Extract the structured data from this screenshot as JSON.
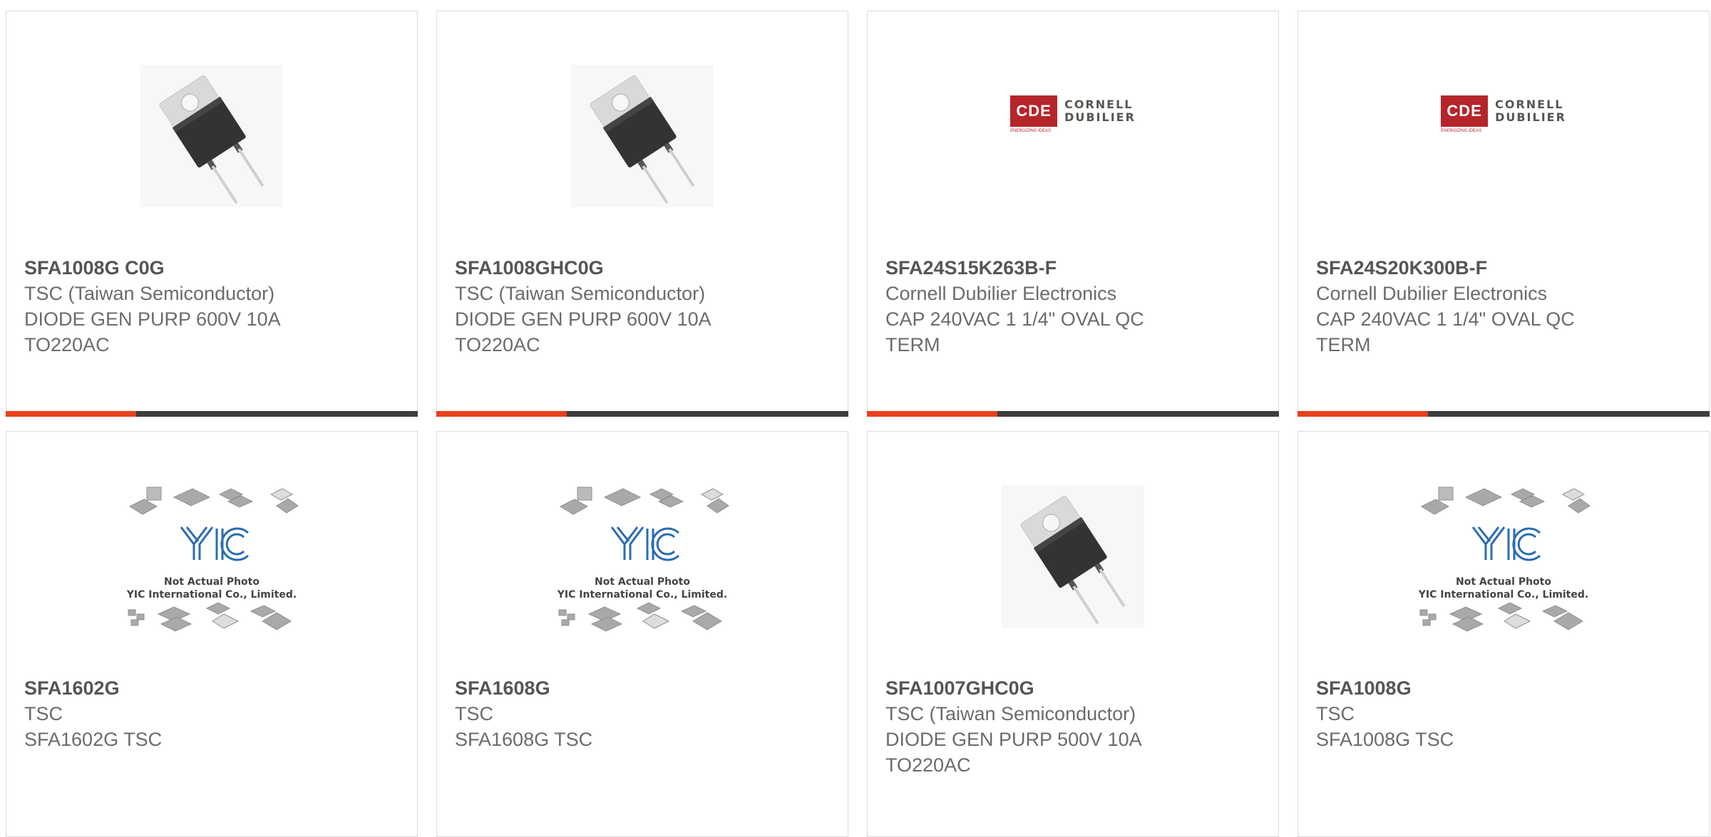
{
  "products": [
    {
      "part_number": "SFA1008G C0G",
      "manufacturer": "TSC (Taiwan Semiconductor)",
      "description": "DIODE GEN PURP 600V 10A TO220AC",
      "image": "to220-transistor-photo"
    },
    {
      "part_number": "SFA1008GHC0G",
      "manufacturer": "TSC (Taiwan Semiconductor)",
      "description": "DIODE GEN PURP 600V 10A TO220AC",
      "image": "to220-transistor-photo"
    },
    {
      "part_number": "SFA24S15K263B-F",
      "manufacturer": "Cornell Dubilier Electronics",
      "description": "CAP 240VAC 1 1/4\" OVAL QC TERM",
      "image": "cde-logo",
      "logo": {
        "badge": "CDE",
        "line1": "CORNELL",
        "line2": "DUBILIER",
        "tagline": "ENERGIZING IDEAS"
      }
    },
    {
      "part_number": "SFA24S20K300B-F",
      "manufacturer": "Cornell Dubilier Electronics",
      "description": "CAP 240VAC 1 1/4\" OVAL QC TERM",
      "image": "cde-logo",
      "logo": {
        "badge": "CDE",
        "line1": "CORNELL",
        "line2": "DUBILIER",
        "tagline": "ENERGIZING IDEAS"
      }
    },
    {
      "part_number": "SFA1602G",
      "manufacturer": "TSC",
      "description": "SFA1602G TSC",
      "image": "yic-placeholder",
      "placeholder": {
        "line1": "Not Actual Photo",
        "line2": "YIC International Co., Limited."
      }
    },
    {
      "part_number": "SFA1608G",
      "manufacturer": "TSC",
      "description": "SFA1608G TSC",
      "image": "yic-placeholder",
      "placeholder": {
        "line1": "Not Actual Photo",
        "line2": "YIC International Co., Limited."
      }
    },
    {
      "part_number": "SFA1007GHC0G",
      "manufacturer": "TSC (Taiwan Semiconductor)",
      "description": "DIODE GEN PURP 500V 10A TO220AC",
      "image": "to220-transistor-photo"
    },
    {
      "part_number": "SFA1008G",
      "manufacturer": "TSC",
      "description": "SFA1008G TSC",
      "image": "yic-placeholder",
      "placeholder": {
        "line1": "Not Actual Photo",
        "line2": "YIC International Co., Limited."
      }
    }
  ],
  "colors": {
    "accent": "#e8401c",
    "bar": "#3d3d3d",
    "text": "#6b6b6b",
    "border": "#dcdcdc"
  }
}
